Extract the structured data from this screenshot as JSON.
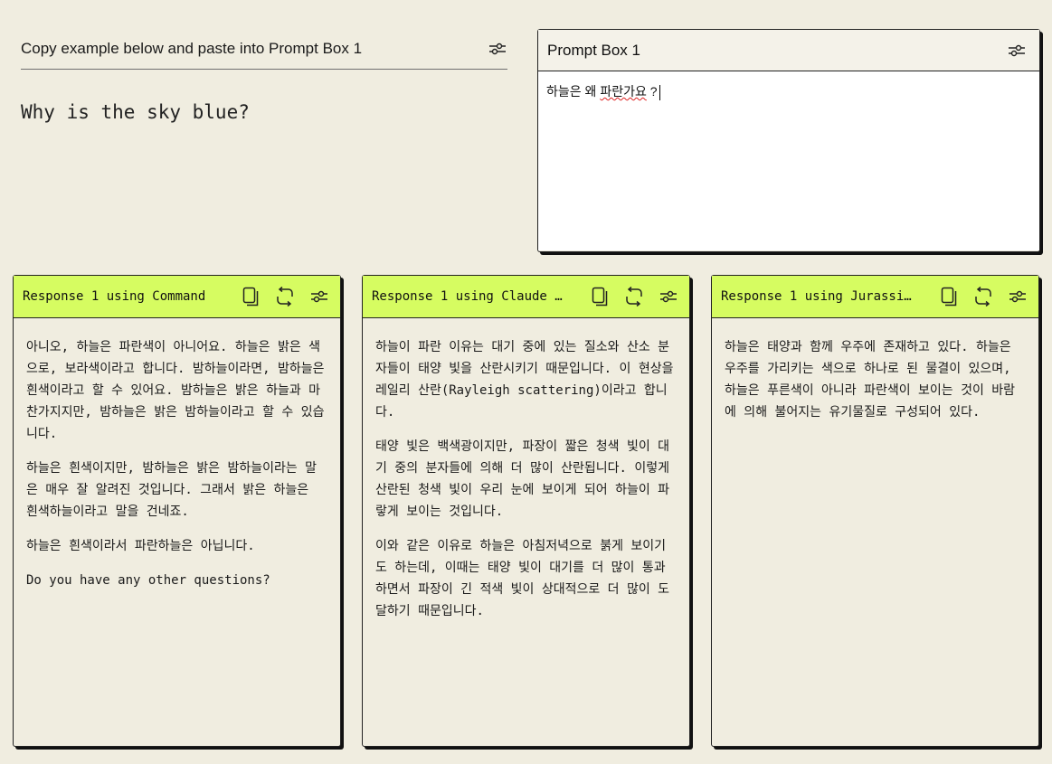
{
  "example": {
    "title": "Copy example below and paste into Prompt Box 1",
    "text": "Why is the sky blue?"
  },
  "prompt_box": {
    "title": "Prompt Box 1",
    "input_prefix": "하늘은 왜 ",
    "input_misspelled": "파란가요",
    "input_suffix": " ?"
  },
  "icons": {
    "settings": "sliders-icon",
    "copy": "copy-icon",
    "regenerate": "regenerate-icon"
  },
  "colors": {
    "accent": "#d6fc61",
    "background": "#f0ede0"
  },
  "responses": [
    {
      "title": "Response 1 using Command",
      "paragraphs": [
        "아니오, 하늘은 파란색이 아니어요. 하늘은 밝은 색으로, 보라색이라고 합니다. 밤하늘이라면, 밤하늘은 흰색이라고 할 수 있어요. 밤하늘은 밝은 하늘과 마찬가지지만, 밤하늘은 밝은 밤하늘이라고 할 수 있습니다.",
        "하늘은 흰색이지만, 밤하늘은 밝은 밤하늘이라는 말은 매우 잘 알려진 것입니다. 그래서 밝은 하늘은 흰색하늘이라고 말을 건네죠.",
        "하늘은 흰색이라서 파란하늘은 아닙니다.",
        "Do you have any other questions?"
      ]
    },
    {
      "title": "Response 1 using Claude …",
      "paragraphs": [
        "하늘이 파란 이유는 대기 중에 있는 질소와 산소 분자들이 태양 빛을 산란시키기 때문입니다. 이 현상을 레일리 산란(Rayleigh scattering)이라고 합니다.",
        "태양 빛은 백색광이지만, 파장이 짧은 청색 빛이 대기 중의 분자들에 의해 더 많이 산란됩니다. 이렇게 산란된 청색 빛이 우리 눈에 보이게 되어 하늘이 파랗게 보이는 것입니다.",
        "이와 같은 이유로 하늘은 아침저녁으로 붉게 보이기도 하는데, 이때는 태양 빛이 대기를 더 많이 통과하면서 파장이 긴 적색 빛이 상대적으로 더 많이 도달하기 때문입니다."
      ]
    },
    {
      "title": "Response 1 using Jurassi…",
      "paragraphs": [
        "하늘은 태양과 함께 우주에 존재하고 있다. 하늘은 우주를 가리키는 색으로 하나로 된 물결이 있으며, 하늘은 푸른색이 아니라 파란색이 보이는 것이 바람에 의해 불어지는 유기물질로 구성되어 있다."
      ]
    }
  ]
}
